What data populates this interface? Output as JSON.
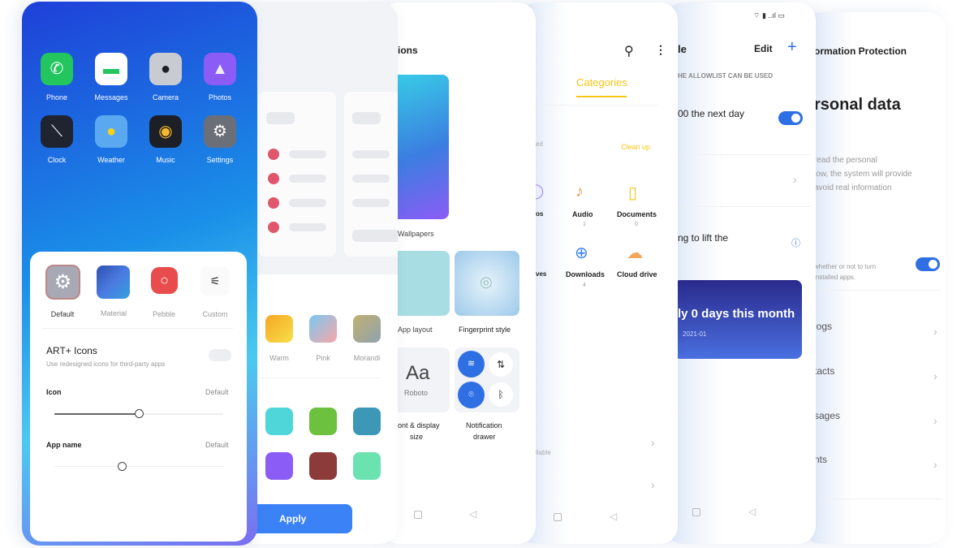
{
  "home": {
    "apps": [
      {
        "label": "Phone",
        "icon": "phone-icon",
        "color": "#22c55e"
      },
      {
        "label": "Messages",
        "icon": "messages-icon",
        "color": "#ffffff"
      },
      {
        "label": "Camera",
        "icon": "camera-icon",
        "color": "#c8ccd2"
      },
      {
        "label": "Photos",
        "icon": "photos-icon",
        "color": "#8b5cf6"
      },
      {
        "label": "Clock",
        "icon": "clock-icon",
        "color": "#1f2430"
      },
      {
        "label": "Weather",
        "icon": "weather-icon",
        "color": "#5aa9f0"
      },
      {
        "label": "Music",
        "icon": "music-icon",
        "color": "#1c1f26"
      },
      {
        "label": "Settings",
        "icon": "settings-icon",
        "color": "#6b7078"
      }
    ]
  },
  "icon_style": {
    "options": [
      {
        "label": "Default"
      },
      {
        "label": "Material"
      },
      {
        "label": "Pebble"
      },
      {
        "label": "Custom"
      }
    ],
    "art_title": "ART+ Icons",
    "art_subtitle": "Use redesigned icons for third-party apps",
    "art_enabled": false,
    "icon_label": "Icon",
    "icon_value": "Default",
    "icon_slider": 0.5,
    "appname_label": "App name",
    "appname_value": "Default",
    "appname_slider": 0.4
  },
  "theme": {
    "gradients": [
      {
        "label": "Warm"
      },
      {
        "label": "Pink"
      },
      {
        "label": "Morandi"
      }
    ],
    "colors": [
      "#4fd6d9",
      "#6cc13f",
      "#3d98b8",
      "#8b5cf6",
      "#8c3a3a",
      "#6be3b0"
    ],
    "apply": "Apply"
  },
  "personalizations": {
    "title": "ions",
    "wallpapers": "Wallpapers",
    "app_layout": "App layout",
    "fingerprint": "Fingerprint style",
    "font_sample": "Aa",
    "font_name": "Roboto",
    "font_label_1": "ont & display",
    "font_label_2": "size",
    "notif_label_1": "Notification",
    "notif_label_2": "drawer"
  },
  "files": {
    "tab": "Categories",
    "accent": "#f5c518",
    "storage_label": "ed",
    "clean_up": "Clean up",
    "categories": [
      {
        "label": "os"
      },
      {
        "label": "Audio",
        "count": "1"
      },
      {
        "label": "Documents",
        "count": "0"
      },
      {
        "label": "ves"
      },
      {
        "label": "Downloads",
        "count": "4"
      },
      {
        "label": "Cloud drive"
      }
    ],
    "available": "ilable"
  },
  "schedule": {
    "title": "le",
    "edit": "Edit",
    "section": "HE ALLOWLIST CAN BE USED",
    "next_day": "00 the next day",
    "next_day_on": true,
    "lift": "ng to lift the",
    "banner_title": "ly 0 days this month",
    "banner_date": "2021-01"
  },
  "privacy": {
    "title": "ormation Protection",
    "heading": "rsonal data",
    "desc": [
      "read the personal",
      "low, the system will provide",
      "avoid real information"
    ],
    "toggle_desc": [
      "whether or not to turn",
      "installed apps."
    ],
    "toggle_on": true,
    "items": [
      "logs",
      "tacts",
      "sages",
      "nts"
    ]
  }
}
